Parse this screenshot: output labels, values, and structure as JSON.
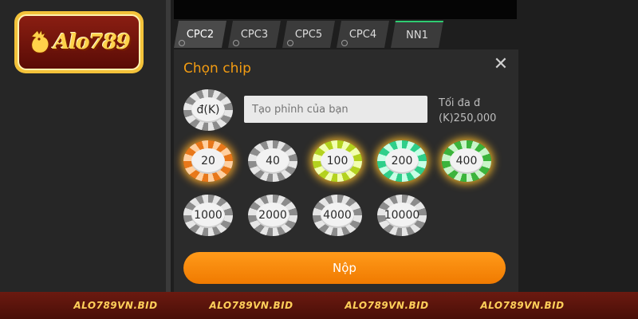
{
  "brand": {
    "logo_text": "Alo789"
  },
  "tabs": [
    {
      "label": "CPC2",
      "active": true
    },
    {
      "label": "CPC3",
      "active": false
    },
    {
      "label": "CPC5",
      "active": false
    },
    {
      "label": "CPC4",
      "active": false
    },
    {
      "label": "NN1",
      "active": false
    }
  ],
  "chip_panel": {
    "title": "Chọn chip",
    "close_glyph": "✕",
    "custom_chip_label": "đ(K)",
    "custom_input_placeholder": "Tạo phỉnh của bạn",
    "max_label": "Tối đa đ (K)250,000",
    "chips_row1": [
      "20",
      "40",
      "100",
      "200",
      "400"
    ],
    "chips_row2": [
      "1000",
      "2000",
      "4000",
      "10000"
    ],
    "submit_label": "Nộp"
  },
  "footer": {
    "watermark": "ALO789VN.BID"
  },
  "colors": {
    "accent": "#f39c12",
    "submit": "#f28500",
    "footer_bg": "#5a140b",
    "footer_text": "#ffcf5a"
  }
}
